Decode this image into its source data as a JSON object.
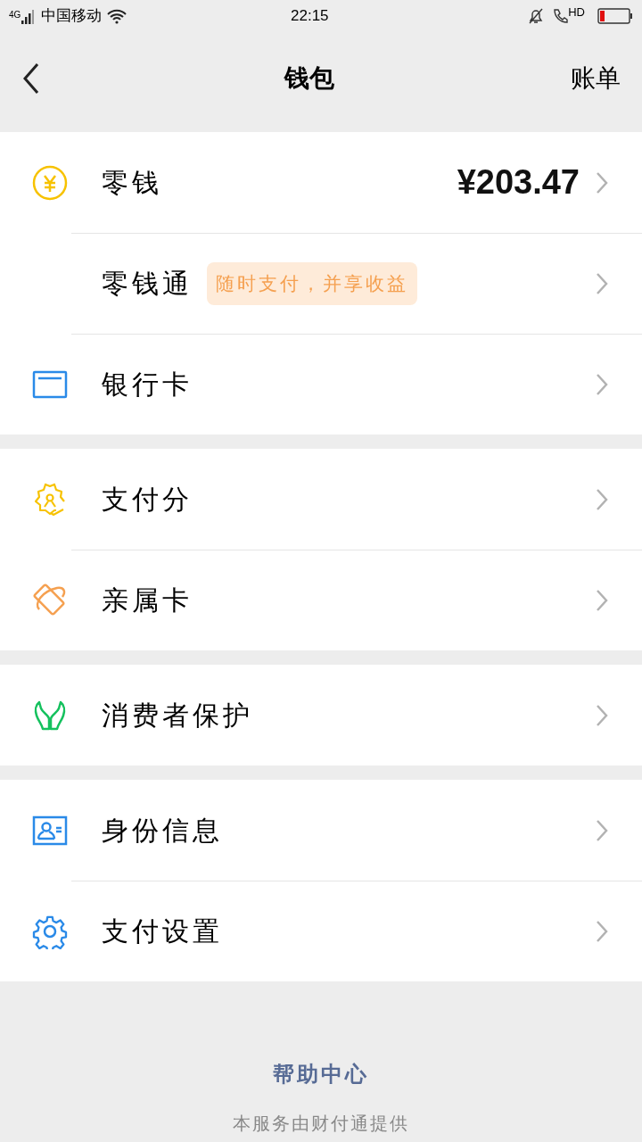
{
  "status_bar": {
    "network": "4G",
    "carrier": "中国移动",
    "time": "22:15",
    "call_label": "HD"
  },
  "header": {
    "title": "钱包",
    "action": "账单"
  },
  "groups": [
    {
      "items": [
        {
          "kind": "coin",
          "label": "零钱",
          "value": "¥203.47"
        },
        {
          "kind": "plain",
          "label": "零钱通",
          "badge": "随时支付，并享收益"
        },
        {
          "kind": "card",
          "label": "银行卡"
        }
      ]
    },
    {
      "items": [
        {
          "kind": "badge",
          "label": "支付分"
        },
        {
          "kind": "family",
          "label": "亲属卡"
        }
      ]
    },
    {
      "items": [
        {
          "kind": "hands",
          "label": "消费者保护"
        }
      ]
    },
    {
      "items": [
        {
          "kind": "id",
          "label": "身份信息"
        },
        {
          "kind": "gear",
          "label": "支付设置"
        }
      ]
    }
  ],
  "footer": {
    "link": "帮助中心",
    "note": "本服务由财付通提供"
  }
}
